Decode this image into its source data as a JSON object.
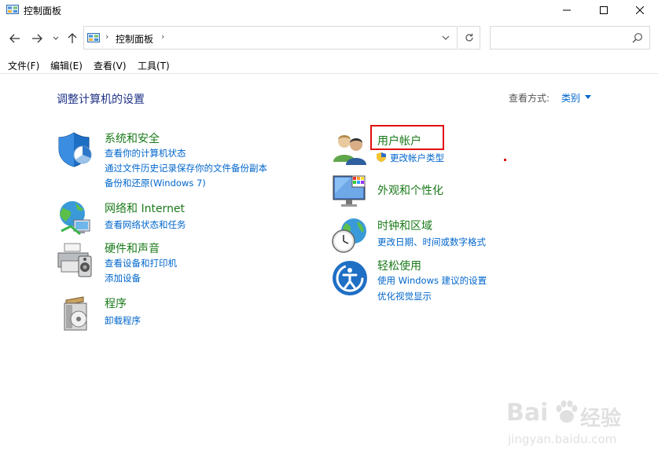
{
  "window": {
    "title": "控制面板"
  },
  "address": {
    "path": "控制面板",
    "search_placeholder": ""
  },
  "menu": {
    "items": [
      "文件(F)",
      "编辑(E)",
      "查看(V)",
      "工具(T)"
    ]
  },
  "main": {
    "title": "调整计算机的设置",
    "view_label": "查看方式:",
    "view_value": "类别"
  },
  "categories": [
    {
      "title": "系统和安全",
      "links": [
        "查看你的计算机状态",
        "通过文件历史记录保存你的文件备份副本",
        "备份和还原(Windows 7)"
      ]
    },
    {
      "title": "网络和 Internet",
      "links": [
        "查看网络状态和任务"
      ]
    },
    {
      "title": "硬件和声音",
      "links": [
        "查看设备和打印机",
        "添加设备"
      ]
    },
    {
      "title": "程序",
      "links": [
        "卸载程序"
      ]
    },
    {
      "title": "用户帐户",
      "links": [
        "更改帐户类型"
      ]
    },
    {
      "title": "外观和个性化",
      "links": []
    },
    {
      "title": "时钟和区域",
      "links": [
        "更改日期、时间或数字格式"
      ]
    },
    {
      "title": "轻松使用",
      "links": [
        "使用 Windows 建议的设置",
        "优化视觉显示"
      ]
    }
  ],
  "watermark": {
    "brand": "Bai",
    "brand2": "经验",
    "url": "jingyan.baidu.com"
  },
  "colors": {
    "link": "#0066cc",
    "category_title": "#1a7a1a",
    "page_title": "#1e3287",
    "highlight": "#e01010"
  }
}
